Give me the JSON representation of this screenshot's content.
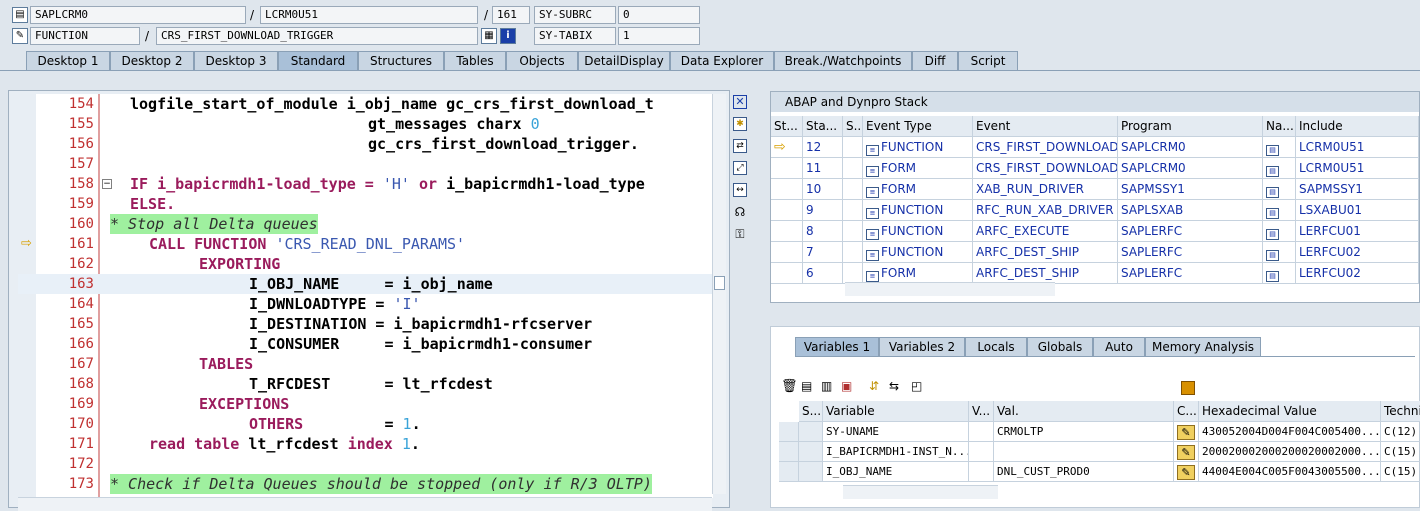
{
  "header": {
    "program": "SAPLCRM0",
    "include": "LCRM0U51",
    "line": "161",
    "subrc_label": "SY-SUBRC",
    "subrc_value": "0",
    "event_type": "FUNCTION",
    "event": "CRS_FIRST_DOWNLOAD_TRIGGER",
    "tabix_label": "SY-TABIX",
    "tabix_value": "1",
    "slash": "/"
  },
  "tabs": [
    "Desktop 1",
    "Desktop 2",
    "Desktop 3",
    "Standard",
    "Structures",
    "Tables",
    "Objects",
    "DetailDisplay",
    "Data Explorer",
    "Break./Watchpoints",
    "Diff",
    "Script"
  ],
  "code": {
    "line_numbers": [
      "154",
      "155",
      "156",
      "157",
      "158",
      "159",
      "160",
      "161",
      "162",
      "163",
      "164",
      "165",
      "166",
      "167",
      "168",
      "169",
      "170",
      "171",
      "172",
      "173"
    ],
    "l154": "logfile_start_of_module i_obj_name gc_crs_first_download_t",
    "l155_a": "gt_messages charx ",
    "l155_n": "0",
    "l156": "gc_crs_first_download_trigger.",
    "l158_a": "IF i_bapicrmdh1-load_type = ",
    "l158_s": "'H'",
    "l158_or": " or ",
    "l158_b": "i_bapicrmdh1-load_type",
    "l159": "ELSE.",
    "l160": "* Stop all Delta queues",
    "l161_kw": "CALL FUNCTION ",
    "l161_s": "'CRS_READ_DNL_PARAMS'",
    "l162": "EXPORTING",
    "l163": "I_OBJ_NAME     = i_obj_name",
    "l164_a": "I_DWNLOADTYPE = ",
    "l164_s": "'I'",
    "l165": "I_DESTINATION = i_bapicrmdh1-rfcserver",
    "l166": "I_CONSUMER     = i_bapicrmdh1-consumer",
    "l167": "TABLES",
    "l168": "T_RFCDEST      = lt_rfcdest",
    "l169": "EXCEPTIONS",
    "l170_kw": "OTHERS",
    "l170_eq": "         = ",
    "l170_n": "1",
    "l170_dot": ".",
    "l171_kw1": "read table ",
    "l171_v": "lt_rfcdest ",
    "l171_kw2": "index ",
    "l171_n": "1",
    "l171_dot": ".",
    "l173": "* Check if Delta Queues should be stopped (only if R/3 OLTP)"
  },
  "stack": {
    "title": "ABAP and Dynpro Stack",
    "columns": [
      "St...",
      "Sta...",
      "S...",
      "Event Type",
      "Event",
      "Program",
      "Na...",
      "Include"
    ],
    "rows": [
      {
        "level": "12",
        "type": "FUNCTION",
        "event": "CRS_FIRST_DOWNLOAD...",
        "program": "SAPLCRM0",
        "include": "LCRM0U51"
      },
      {
        "level": "11",
        "type": "FORM",
        "event": "CRS_FIRST_DOWNLOAD...",
        "program": "SAPLCRM0",
        "include": "LCRM0U51"
      },
      {
        "level": "10",
        "type": "FORM",
        "event": "XAB_RUN_DRIVER",
        "program": "SAPMSSY1",
        "include": "SAPMSSY1"
      },
      {
        "level": "9",
        "type": "FUNCTION",
        "event": "RFC_RUN_XAB_DRIVER",
        "program": "SAPLSXAB",
        "include": "LSXABU01"
      },
      {
        "level": "8",
        "type": "FUNCTION",
        "event": "ARFC_EXECUTE",
        "program": "SAPLERFC",
        "include": "LERFCU01"
      },
      {
        "level": "7",
        "type": "FUNCTION",
        "event": "ARFC_DEST_SHIP",
        "program": "SAPLERFC",
        "include": "LERFCU02"
      },
      {
        "level": "6",
        "type": "FORM",
        "event": "ARFC_DEST_SHIP",
        "program": "SAPLERFC",
        "include": "LERFCU02"
      }
    ]
  },
  "vars": {
    "tabs": [
      "Variables 1",
      "Variables 2",
      "Locals",
      "Globals",
      "Auto",
      "Memory Analysis"
    ],
    "columns": [
      "S...",
      "Variable",
      "V...",
      "Val.",
      "C...",
      "Hexadecimal Value",
      "Techni"
    ],
    "rows": [
      {
        "name": "SY-UNAME",
        "value": "CRMOLTP",
        "hex": "430052004D004F004C005400...",
        "tech": "C(12)"
      },
      {
        "name": "I_BAPICRMDH1-INST_N...",
        "value": "",
        "hex": "200020002000200020002000...",
        "tech": "C(15)"
      },
      {
        "name": "I_OBJ_NAME",
        "value": "DNL_CUST_PROD0",
        "hex": "44004E004C005F0043005500...",
        "tech": "C(15)"
      }
    ]
  },
  "icons": {
    "close": "close-icon",
    "new_tool": "new-tool-icon",
    "replace_tool": "replace-tool-icon",
    "full_screen": "full-screen-icon",
    "swap": "swap-icon",
    "services": "services-icon",
    "shortcuts": "shortcuts-icon"
  }
}
